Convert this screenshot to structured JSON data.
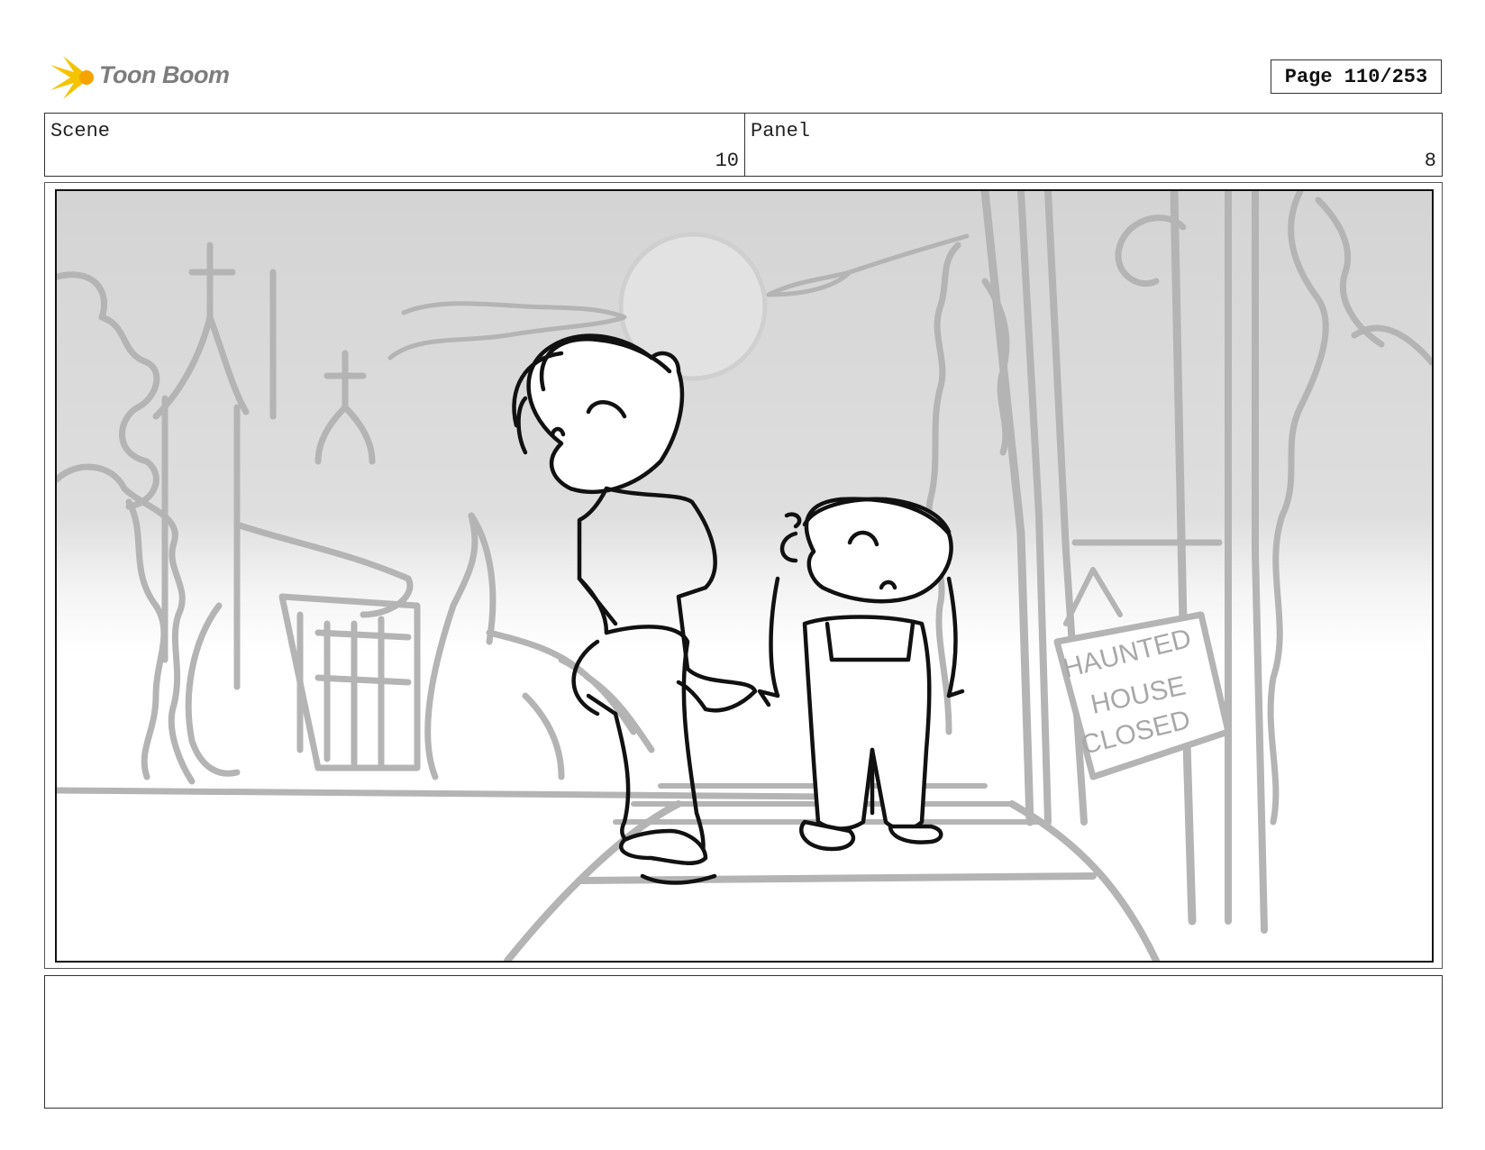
{
  "header": {
    "logo_text": "Toon Boom",
    "page_indicator": "Page 110/253"
  },
  "panel_info": {
    "scene_label": "Scene",
    "scene_number": "10",
    "panel_label": "Panel",
    "panel_number": "8"
  },
  "artwork": {
    "sign_lines": [
      "HAUNTED",
      "HOUSE",
      "CLOSED"
    ],
    "colors": {
      "sketch_gray": "#b4b4b4",
      "ink_black": "#111111",
      "sky_top": "#d6d6d6",
      "ground": "#ffffff"
    }
  },
  "notes": {
    "text": ""
  }
}
